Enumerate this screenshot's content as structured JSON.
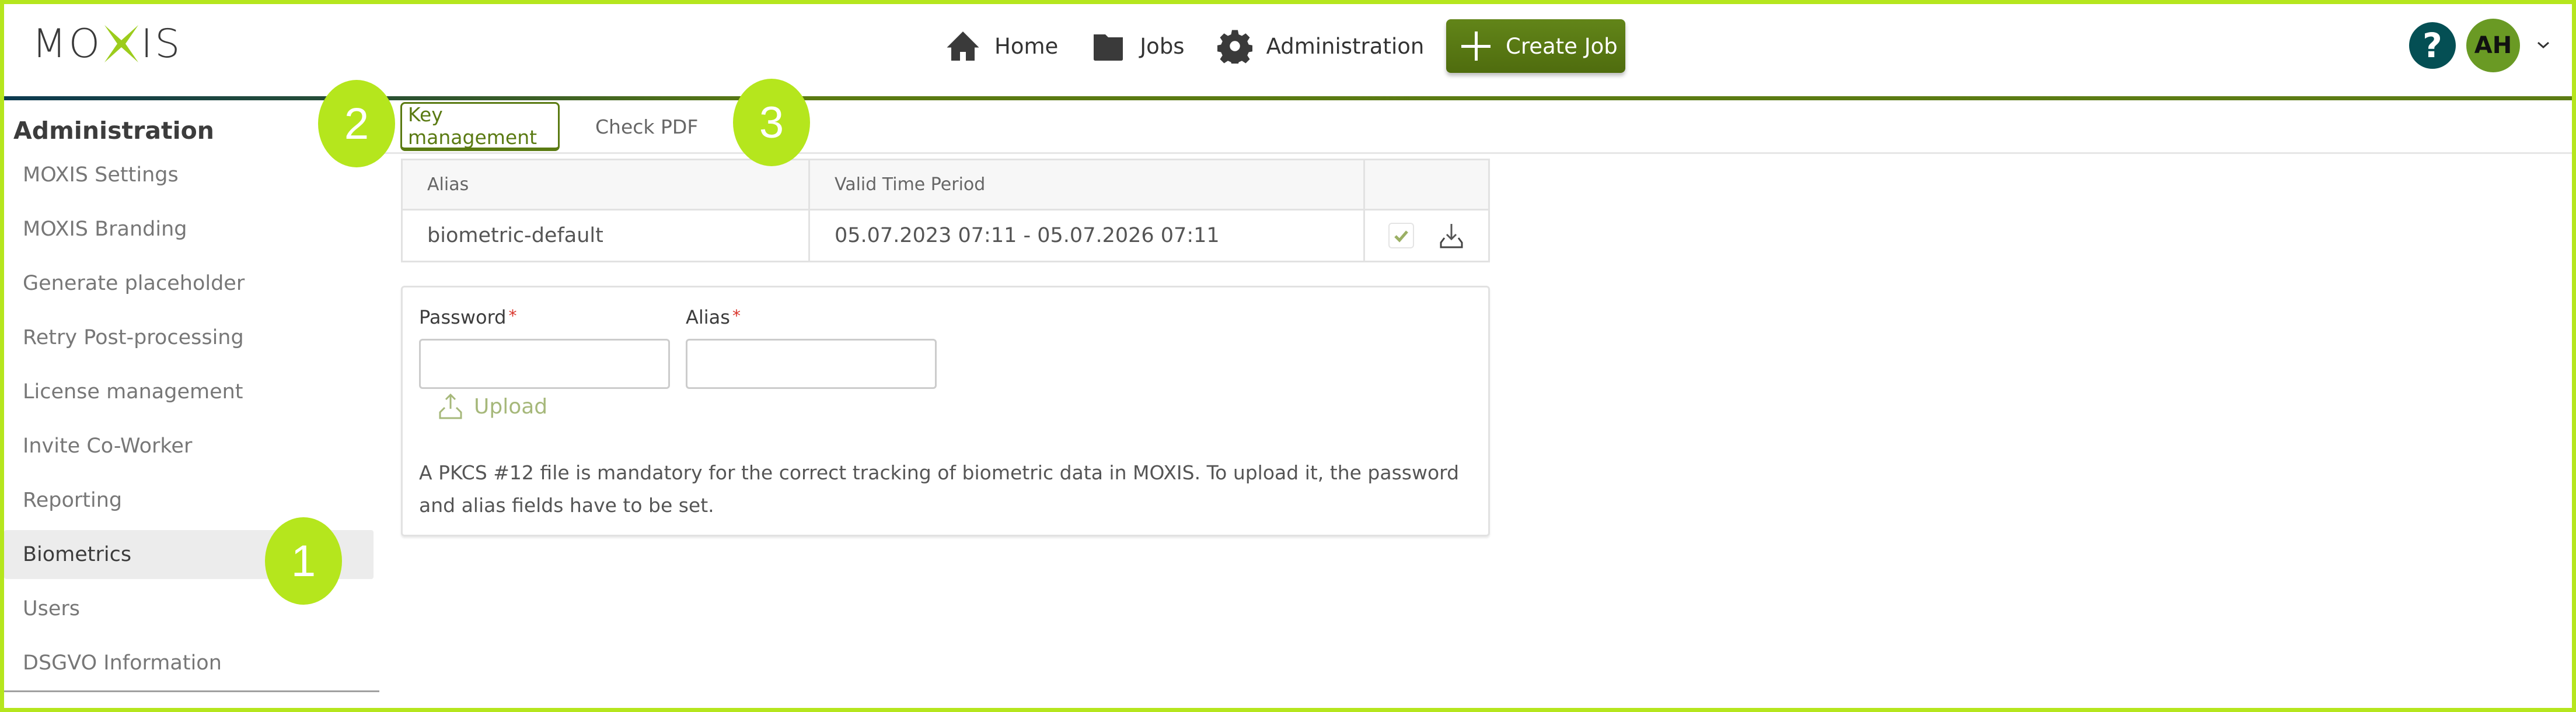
{
  "app": {
    "logo_text_left": "MO",
    "logo_text_right": "IS",
    "brand_color": "#5a7a12",
    "accent_color": "#b5e61d"
  },
  "header": {
    "nav": [
      {
        "label": "Home",
        "icon": "home-icon"
      },
      {
        "label": "Jobs",
        "icon": "folder-icon"
      },
      {
        "label": "Administration",
        "icon": "gear-icon"
      }
    ],
    "create_job_label": "Create Job",
    "help_label": "?",
    "avatar_initials": "AH"
  },
  "sidebar": {
    "title": "Administration",
    "items": [
      {
        "label": "MOXIS Settings",
        "active": false
      },
      {
        "label": "MOXIS Branding",
        "active": false
      },
      {
        "label": "Generate placeholder",
        "active": false
      },
      {
        "label": "Retry Post-processing",
        "active": false
      },
      {
        "label": "License management",
        "active": false
      },
      {
        "label": "Invite Co-Worker",
        "active": false
      },
      {
        "label": "Reporting",
        "active": false
      },
      {
        "label": "Biometrics",
        "active": true
      },
      {
        "label": "Users",
        "active": false
      },
      {
        "label": "DSGVO Information",
        "active": false
      }
    ]
  },
  "tabs": [
    {
      "label": "Key management",
      "active": true
    },
    {
      "label": "Check PDF",
      "active": false
    }
  ],
  "table": {
    "headers": [
      "Alias",
      "Valid Time Period",
      ""
    ],
    "rows": [
      {
        "alias": "biometric-default",
        "valid_period": "05.07.2023 07:11 - 05.07.2026 07:11",
        "checked": true
      }
    ]
  },
  "form": {
    "password_label": "Password",
    "alias_label": "Alias",
    "required_mark": "*",
    "password_value": "",
    "alias_value": "",
    "upload_label": "Upload",
    "info_text": "A PKCS #12 file is mandatory for the correct tracking of biometric data in MOXIS. To upload it, the password and alias fields have to be set."
  },
  "callouts": [
    "1",
    "2",
    "3"
  ]
}
